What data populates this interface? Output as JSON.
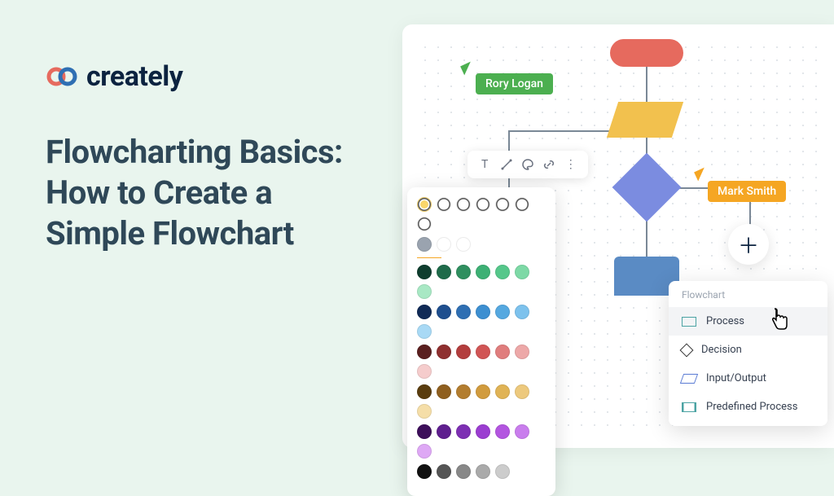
{
  "brand": "creately",
  "headline": "Flowcharting Basics: How to Create a Simple Flowchart",
  "collaborators": {
    "user1": "Rory Logan",
    "user2": "Mark Smith"
  },
  "shape_menu": {
    "title": "Flowchart",
    "items": [
      "Process",
      "Decision",
      "Input/Output",
      "Predefined Process"
    ]
  },
  "palette": {
    "row_outline": [
      "#f9d66b",
      "#ffffff",
      "#ffffff",
      "#ffffff",
      "#ffffff",
      "#ffffff",
      "#ffffff"
    ],
    "row_neutral": [
      "#9aa3af",
      "#ffffff",
      "#ffffff"
    ],
    "row1": [
      "#0f3d2e",
      "#1f6b4a",
      "#2f8f5f",
      "#3db074",
      "#55c78a",
      "#7dd9a6",
      "#a8e8c4"
    ],
    "row2": [
      "#102a56",
      "#1f4f8f",
      "#2f6fb3",
      "#3d8fd1",
      "#55a8e0",
      "#7dc2ed",
      "#a8d9f5"
    ],
    "row3": [
      "#5a1f1f",
      "#8f2f2f",
      "#b33d3d",
      "#d15555",
      "#e07d7d",
      "#eda8a8",
      "#f5cccc"
    ],
    "row4": [
      "#5a3d0f",
      "#8f5f1f",
      "#b37d2f",
      "#d19b3d",
      "#e0b355",
      "#edc97d",
      "#f5dea8"
    ],
    "row5": [
      "#3d0f5a",
      "#5f1f8f",
      "#7d2fb3",
      "#9b3dd1",
      "#b355e0",
      "#c97ded",
      "#dea8f5"
    ],
    "row6": [
      "#111111",
      "#555555",
      "#888888",
      "#aaaaaa",
      "#cccccc"
    ]
  }
}
